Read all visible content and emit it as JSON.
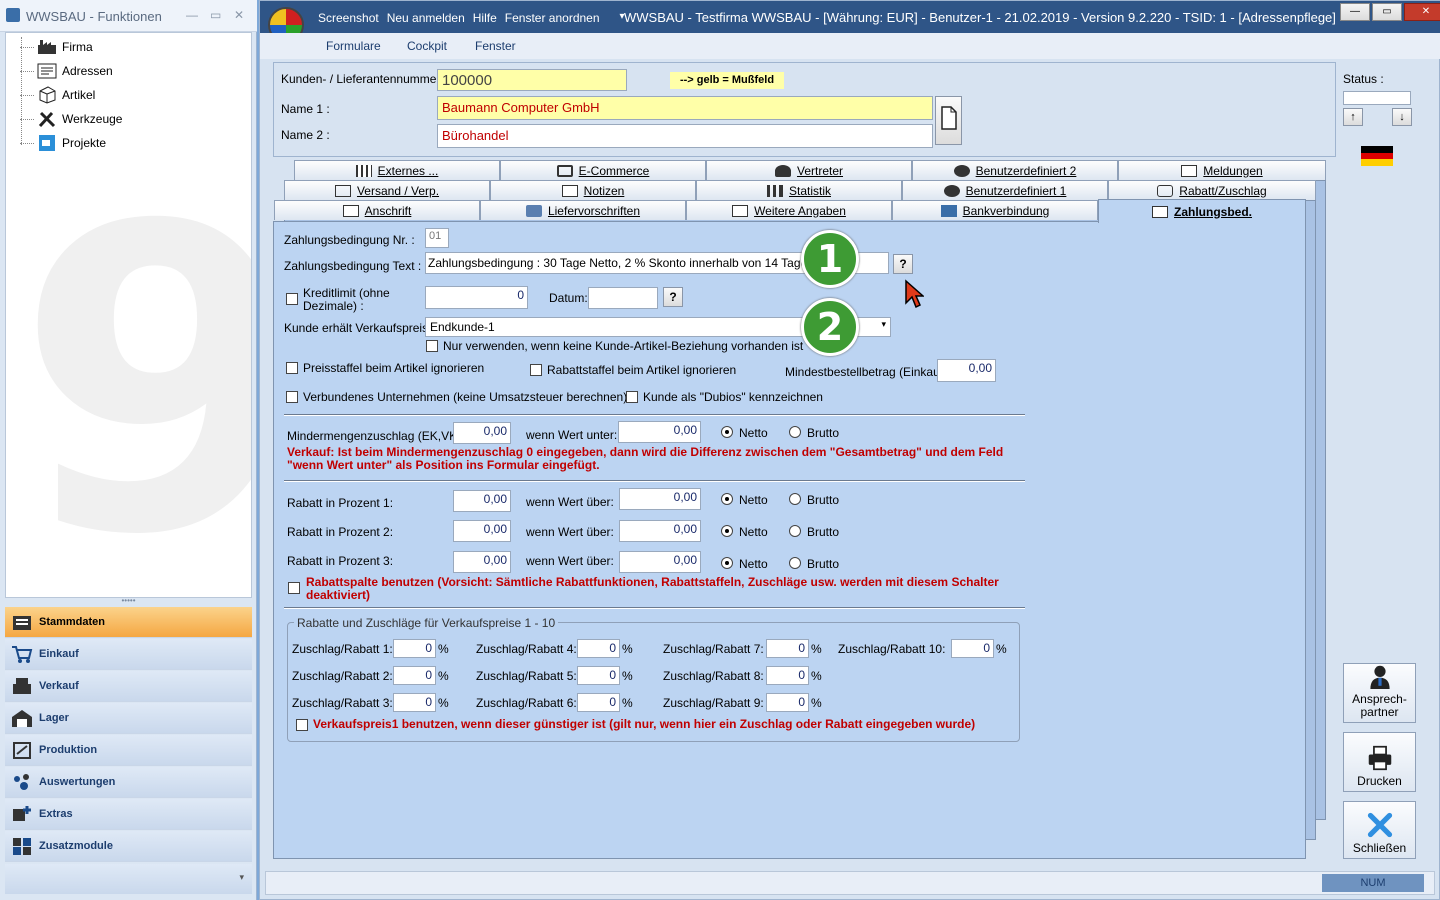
{
  "left_window": {
    "title": "WWSBAU - Funktionen",
    "tree": [
      "Firma",
      "Adressen",
      "Artikel",
      "Werkzeuge",
      "Projekte"
    ],
    "nav": [
      "Stammdaten",
      "Einkauf",
      "Verkauf",
      "Lager",
      "Produktion",
      "Auswertungen",
      "Extras",
      "Zusatzmodule"
    ],
    "active_nav": "Stammdaten"
  },
  "main_window": {
    "title_menu": [
      "Screenshot",
      "Neu anmelden",
      "Hilfe",
      "Fenster anordnen"
    ],
    "title": "WWSBAU - Testfirma WWSBAU - [Währung: EUR] - Benutzer-1 - 21.02.2019 - Version 9.2.220 - TSID: 1 - [Adressenpflege]",
    "menu": [
      "Formulare",
      "Cockpit",
      "Fenster"
    ],
    "status_num": "NUM"
  },
  "header": {
    "kunde_label": "Kunden- / Lieferantennummer :",
    "kunde_value": "100000",
    "hint": "--> gelb = Mußfeld",
    "name1_label": "Name 1 :",
    "name1_value": "Baumann Computer GmbH",
    "name2_label": "Name 2 :",
    "name2_value": "Bürohandel",
    "status_label": "Status :",
    "status_value": ""
  },
  "tabs": {
    "row1": [
      "Externes ...",
      "E-Commerce",
      "Vertreter",
      "Benutzerdefiniert 2",
      "Meldungen"
    ],
    "row2": [
      "Versand / Verp.",
      "Notizen",
      "Statistik",
      "Benutzerdefiniert 1",
      "Rabatt/Zuschlag"
    ],
    "row3": [
      "Anschrift",
      "Liefervorschriften",
      "Weitere Angaben",
      "Bankverbindung",
      "Zahlungsbed."
    ],
    "active": "Zahlungsbed."
  },
  "form": {
    "zb_nr_label": "Zahlungsbedingung Nr. :",
    "zb_nr_value": "01",
    "zb_text_label": "Zahlungsbedingung Text :",
    "zb_text_value": "Zahlungsbedingung : 30 Tage Netto, 2 % Skonto innerhalb von 14 Tagen",
    "kredit_label": "Kreditlimit (ohne Dezimale) :",
    "kredit_value": "0",
    "datum_label": "Datum:",
    "datum_value": "",
    "vk_label": "Kunde erhält Verkaufspreis :",
    "vk_value": "Endkunde-1",
    "nur_label": "Nur verwenden, wenn keine Kunde-Artikel-Beziehung vorhanden ist",
    "preisstaffel_label": "Preisstaffel beim Artikel ignorieren",
    "rabattstaffel_label": "Rabattstaffel beim Artikel ignorieren",
    "mindest_label": "Mindestbestellbetrag (Einkauf):",
    "mindest_value": "0,00",
    "verbunden_label": "Verbundenes Unternehmen (keine Umsatzsteuer berechnen)",
    "dubios_label": "Kunde als \"Dubios\" kennzeichnen",
    "mmz_label": "Mindermengenzuschlag (EK,VK):",
    "mmz_value": "0,00",
    "wenn_unter_label": "wenn Wert unter:",
    "wenn_unter_value": "0,00",
    "netto": "Netto",
    "brutto": "Brutto",
    "mmz_note": "Verkauf: Ist beim Mindermengenzuschlag 0 eingegeben, dann wird die Differenz zwischen dem \"Gesamtbetrag\" und dem Feld \"wenn Wert unter\"  als  Position ins Formular eingefügt.",
    "rabatt_rows": [
      {
        "label": "Rabatt in Prozent 1:",
        "value": "0,00",
        "ueber_label": "wenn Wert über:",
        "ueber_value": "0,00"
      },
      {
        "label": "Rabatt in Prozent 2:",
        "value": "0,00",
        "ueber_label": "wenn Wert über:",
        "ueber_value": "0,00"
      },
      {
        "label": "Rabatt in Prozent 3:",
        "value": "0,00",
        "ueber_label": "wenn Wert über:",
        "ueber_value": "0,00"
      }
    ],
    "rabattspalte_note": "Rabattspalte benutzen (Vorsicht: Sämtliche Rabattfunktionen, Rabattstaffeln, Zuschläge usw. werden mit diesem Schalter deaktiviert)",
    "group_title": "Rabatte und Zuschläge für Verkaufspreise 1 - 10",
    "zuschlag": [
      {
        "label": "Zuschlag/Rabatt 1:",
        "value": "0"
      },
      {
        "label": "Zuschlag/Rabatt 2:",
        "value": "0"
      },
      {
        "label": "Zuschlag/Rabatt 3:",
        "value": "0"
      },
      {
        "label": "Zuschlag/Rabatt 4:",
        "value": "0"
      },
      {
        "label": "Zuschlag/Rabatt 5:",
        "value": "0"
      },
      {
        "label": "Zuschlag/Rabatt 6:",
        "value": "0"
      },
      {
        "label": "Zuschlag/Rabatt 7:",
        "value": "0"
      },
      {
        "label": "Zuschlag/Rabatt 8:",
        "value": "0"
      },
      {
        "label": "Zuschlag/Rabatt 9:",
        "value": "0"
      },
      {
        "label": "Zuschlag/Rabatt 10:",
        "value": "0"
      }
    ],
    "percent": "%",
    "vk1_note": "Verkaufspreis1 benutzen, wenn dieser günstiger ist (gilt nur, wenn hier ein Zuschlag oder Rabatt eingegeben wurde)",
    "question": "?"
  },
  "badges": [
    "1",
    "2"
  ],
  "right_buttons": {
    "ansprech": "Ansprech-\npartner",
    "drucken": "Drucken",
    "schliessen": "Schließen"
  },
  "colors": {
    "accent_red": "#c00000",
    "badge_green": "#3e9b34",
    "required_yellow": "#ffffa8",
    "titlebar": "#2f5587"
  }
}
